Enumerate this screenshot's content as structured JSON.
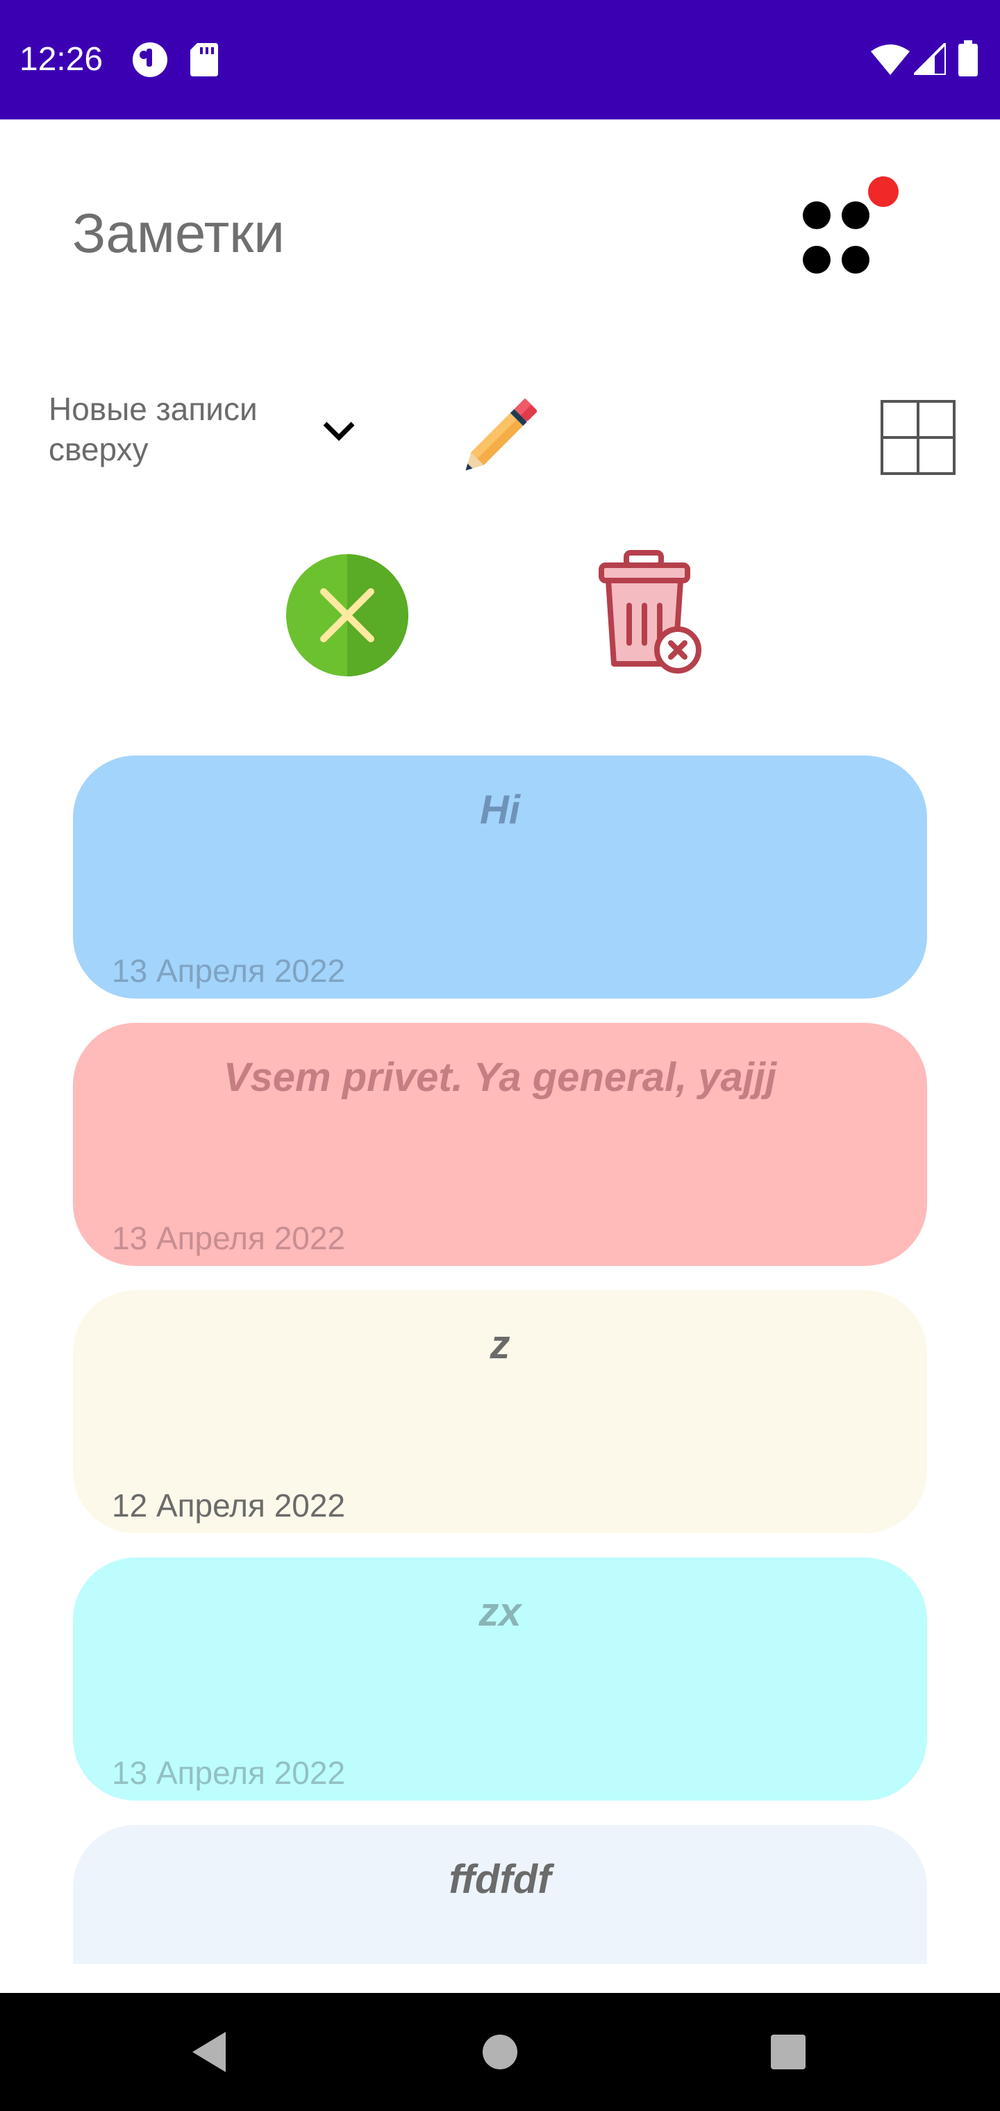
{
  "status_bar": {
    "time": "12:26",
    "background": "#3c00b3",
    "left_icons": [
      "notification-dot-icon",
      "sd-card-icon"
    ],
    "right_icons": [
      "wifi-icon",
      "cellular-signal-icon",
      "battery-icon"
    ]
  },
  "header": {
    "title": "Заметки",
    "menu_icon": "four-dots-menu-icon",
    "menu_badge_color": "#f02828"
  },
  "toolbar": {
    "sort_label": "Новые записи\nсверху",
    "sort_chevron_icon": "chevron-down-icon",
    "edit_icon": "pencil-icon",
    "layout_icon": "grid-view-icon",
    "close_icon": "close-circle-icon",
    "close_color": "#6cc12f",
    "trash_icon": "trash-delete-icon",
    "trash_color": "#b5404c"
  },
  "notes": [
    {
      "title": "Hi",
      "date": "13 Апреля 2022",
      "bg": "#a3d4fb",
      "title_color": "#6f93b8",
      "date_color": "#7fa3c2"
    },
    {
      "title": "Vsem privet. Ya general, yajjj",
      "date": "13 Апреля 2022",
      "bg": "#ffbaba",
      "title_color": "#c57e82",
      "date_color": "#c88e92"
    },
    {
      "title": "z",
      "date": "12 Апреля 2022",
      "bg": "#fdf9ea",
      "title_color": "#6b6b6b",
      "date_color": "#6b6b6b"
    },
    {
      "title": "zx",
      "date": "13 Апреля 2022",
      "bg": "#bdfdfd",
      "title_color": "#8ab5b7",
      "date_color": "#93c0c2"
    },
    {
      "title": "ffdfdf",
      "date": "",
      "bg": "#edf4fb",
      "title_color": "#6b6b6b",
      "date_color": "#6b6b6b"
    }
  ],
  "nav_bar": {
    "back_icon": "back-triangle-icon",
    "home_icon": "home-circle-icon",
    "recents_icon": "recents-square-icon"
  }
}
